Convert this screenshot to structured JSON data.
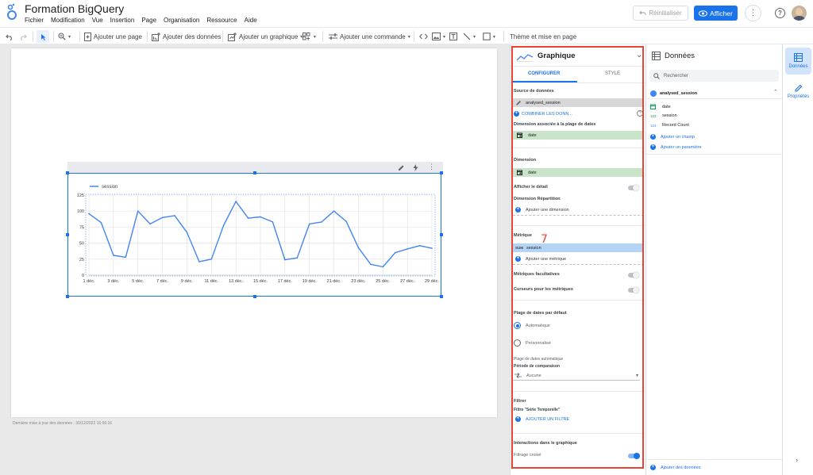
{
  "header": {
    "title": "Formation BigQuery",
    "menu": [
      "Fichier",
      "Modification",
      "Vue",
      "Insertion",
      "Page",
      "Organisation",
      "Ressource",
      "Aide"
    ],
    "reset_label": "Réinitialiser",
    "view_label": "Afficher"
  },
  "toolbar": {
    "add_page": "Ajouter une page",
    "add_data": "Ajouter des données",
    "add_chart": "Ajouter un graphique",
    "add_control": "Ajouter une commande",
    "theme": "Thème et mise en page"
  },
  "canvas": {
    "last_update": "Dernière mise à jour des données : 30/12/2022 16:56:16"
  },
  "chart_data": {
    "type": "line",
    "legend_position": "top-left",
    "series": [
      {
        "name": "session",
        "color": "#4285f4",
        "values": [
          96,
          82,
          31,
          28,
          100,
          80,
          90,
          93,
          67,
          21,
          25,
          78,
          115,
          89,
          91,
          83,
          24,
          27,
          80,
          83,
          100,
          84,
          43,
          17,
          13,
          35,
          41,
          46,
          42
        ]
      }
    ],
    "x_tick_labels": [
      "1 déc.",
      "3 déc.",
      "5 déc.",
      "7 déc.",
      "9 déc.",
      "11 déc.",
      "13 déc.",
      "15 déc.",
      "17 déc.",
      "19 déc.",
      "21 déc.",
      "23 déc.",
      "25 déc.",
      "27 déc.",
      "29 déc."
    ],
    "y_ticks": [
      0,
      25,
      50,
      75,
      100,
      125
    ],
    "ylim": [
      0,
      125
    ],
    "grid": true
  },
  "config_panel": {
    "title": "Graphique",
    "tabs": [
      "CONFIGURER",
      "STYLE"
    ],
    "data_source_label": "Source de données",
    "data_source_value": "analysed_session",
    "blend_link": "COMBINER LES DONN...",
    "date_dim_label": "Dimension associée à la plage de dates",
    "date_dim_value": "date",
    "dimension_label": "Dimension",
    "dimension_value": "date",
    "drill_label": "Afficher le détail",
    "breakdown_label": "Dimension Répartition",
    "add_dimension": "Ajouter une dimension",
    "annotation": "7",
    "metric_label": "Métrique",
    "metric_agg": "SUM",
    "metric_value": "session",
    "add_metric": "Ajouter une métrique",
    "optional_metrics": "Métriques facultatives",
    "metric_sliders": "Curseurs pour les métriques",
    "date_range_label": "Plage de dates par défaut",
    "auto_label": "Automatique",
    "custom_label": "Personnalisé",
    "auto_range_label": "Plage de dates automatique",
    "compare_label": "Période de comparaison",
    "compare_value": "Aucune",
    "filter_label": "Filtrer",
    "filter_sub": "Filtre \"Série Temporelle\"",
    "add_filter": "AJOUTER UN FILTRE",
    "interactions_label": "Interactions dans le graphique",
    "cross_filter": "Filtrage croisé"
  },
  "data_panel": {
    "title": "Données",
    "search_placeholder": "Rechercher",
    "source": "analysed_session",
    "fields": [
      {
        "type": "date",
        "name": "date"
      },
      {
        "type": "123",
        "name": "session"
      },
      {
        "type": "123",
        "name": "Record Count"
      }
    ],
    "add_field": "Ajouter un champ",
    "add_param": "Ajouter un paramètre",
    "add_data": "Ajouter des données"
  },
  "rail": {
    "data_label": "Données",
    "props_label": "Propriétés"
  }
}
